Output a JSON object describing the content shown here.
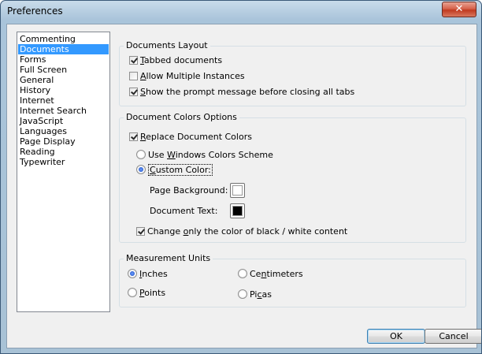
{
  "window": {
    "title": "Preferences",
    "close_glyph": "✕"
  },
  "categories": [
    {
      "label": "Commenting",
      "selected": false
    },
    {
      "label": "Documents",
      "selected": true
    },
    {
      "label": "Forms",
      "selected": false
    },
    {
      "label": "Full Screen",
      "selected": false
    },
    {
      "label": "General",
      "selected": false
    },
    {
      "label": "History",
      "selected": false
    },
    {
      "label": "Internet",
      "selected": false
    },
    {
      "label": "Internet Search",
      "selected": false
    },
    {
      "label": "JavaScript",
      "selected": false
    },
    {
      "label": "Languages",
      "selected": false
    },
    {
      "label": "Page Display",
      "selected": false
    },
    {
      "label": "Reading",
      "selected": false
    },
    {
      "label": "Typewriter",
      "selected": false
    }
  ],
  "documents_layout": {
    "title": "Documents Layout",
    "tabbed_documents": {
      "label_pre": "",
      "label_key": "T",
      "label_post": "abbed documents",
      "checked": true
    },
    "allow_multiple": {
      "label_pre": "",
      "label_key": "A",
      "label_post": "llow Multiple Instances",
      "checked": false
    },
    "show_prompt": {
      "label_pre": "",
      "label_key": "S",
      "label_post": "how the prompt message before closing all tabs",
      "checked": true
    }
  },
  "colors": {
    "title": "Document Colors Options",
    "replace": {
      "label_pre": "",
      "label_key": "R",
      "label_post": "eplace Document Colors",
      "checked": true
    },
    "use_windows": {
      "label_pre": "Use ",
      "label_key": "W",
      "label_post": "indows Colors Scheme",
      "checked": false
    },
    "custom": {
      "label_pre": "",
      "label_key": "C",
      "label_post": "ustom Color:",
      "checked": true
    },
    "page_background_label": "Page Background:",
    "page_background_color": "#ffffff",
    "document_text_label": "Document Text:",
    "document_text_color": "#000000",
    "change_only": {
      "label_pre": "Change ",
      "label_key": "o",
      "label_post": "nly  the color of black / white content",
      "checked": true
    }
  },
  "units": {
    "title": "Measurement Units",
    "inches": {
      "label_pre": "",
      "label_key": "I",
      "label_post": "nches",
      "checked": true
    },
    "centimeters": {
      "label_pre": "Ce",
      "label_key": "n",
      "label_post": "timeters",
      "checked": false
    },
    "points": {
      "label_pre": "",
      "label_key": "P",
      "label_post": "oints",
      "checked": false
    },
    "picas": {
      "label_pre": "Pi",
      "label_key": "c",
      "label_post": "as",
      "checked": false
    }
  },
  "buttons": {
    "ok": "OK",
    "cancel": "Cancel"
  }
}
